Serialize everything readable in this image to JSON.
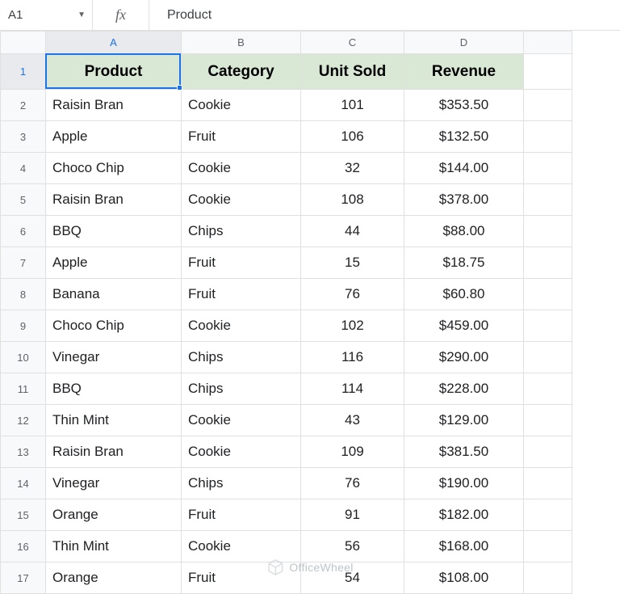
{
  "namebox": {
    "value": "A1"
  },
  "fx_label": "fx",
  "formula_bar": {
    "value": "Product"
  },
  "columns": [
    "A",
    "B",
    "C",
    "D"
  ],
  "selected_col": "A",
  "selected_row": 1,
  "row_numbers": [
    1,
    2,
    3,
    4,
    5,
    6,
    7,
    8,
    9,
    10,
    11,
    12,
    13,
    14,
    15,
    16,
    17
  ],
  "headers": {
    "A": "Product",
    "B": "Category",
    "C": "Unit Sold",
    "D": "Revenue"
  },
  "rows": [
    {
      "product": "Raisin Bran",
      "category": "Cookie",
      "unit_sold": "101",
      "revenue": "$353.50"
    },
    {
      "product": "Apple",
      "category": "Fruit",
      "unit_sold": "106",
      "revenue": "$132.50"
    },
    {
      "product": "Choco Chip",
      "category": "Cookie",
      "unit_sold": "32",
      "revenue": "$144.00"
    },
    {
      "product": "Raisin Bran",
      "category": "Cookie",
      "unit_sold": "108",
      "revenue": "$378.00"
    },
    {
      "product": "BBQ",
      "category": "Chips",
      "unit_sold": "44",
      "revenue": "$88.00"
    },
    {
      "product": "Apple",
      "category": "Fruit",
      "unit_sold": "15",
      "revenue": "$18.75"
    },
    {
      "product": "Banana",
      "category": "Fruit",
      "unit_sold": "76",
      "revenue": "$60.80"
    },
    {
      "product": "Choco Chip",
      "category": "Cookie",
      "unit_sold": "102",
      "revenue": "$459.00"
    },
    {
      "product": "Vinegar",
      "category": "Chips",
      "unit_sold": "116",
      "revenue": "$290.00"
    },
    {
      "product": "BBQ",
      "category": "Chips",
      "unit_sold": "114",
      "revenue": "$228.00"
    },
    {
      "product": "Thin Mint",
      "category": "Cookie",
      "unit_sold": "43",
      "revenue": "$129.00"
    },
    {
      "product": "Raisin Bran",
      "category": "Cookie",
      "unit_sold": "109",
      "revenue": "$381.50"
    },
    {
      "product": "Vinegar",
      "category": "Chips",
      "unit_sold": "76",
      "revenue": "$190.00"
    },
    {
      "product": "Orange",
      "category": "Fruit",
      "unit_sold": "91",
      "revenue": "$182.00"
    },
    {
      "product": "Thin Mint",
      "category": "Cookie",
      "unit_sold": "56",
      "revenue": "$168.00"
    },
    {
      "product": "Orange",
      "category": "Fruit",
      "unit_sold": "54",
      "revenue": "$108.00"
    }
  ],
  "watermark": "OfficeWheel",
  "chart_data": {
    "type": "table",
    "title": "Product sales",
    "columns": [
      "Product",
      "Category",
      "Unit Sold",
      "Revenue"
    ],
    "rows": [
      [
        "Raisin Bran",
        "Cookie",
        101,
        353.5
      ],
      [
        "Apple",
        "Fruit",
        106,
        132.5
      ],
      [
        "Choco Chip",
        "Cookie",
        32,
        144.0
      ],
      [
        "Raisin Bran",
        "Cookie",
        108,
        378.0
      ],
      [
        "BBQ",
        "Chips",
        44,
        88.0
      ],
      [
        "Apple",
        "Fruit",
        15,
        18.75
      ],
      [
        "Banana",
        "Fruit",
        76,
        60.8
      ],
      [
        "Choco Chip",
        "Cookie",
        102,
        459.0
      ],
      [
        "Vinegar",
        "Chips",
        116,
        290.0
      ],
      [
        "BBQ",
        "Chips",
        114,
        228.0
      ],
      [
        "Thin Mint",
        "Cookie",
        43,
        129.0
      ],
      [
        "Raisin Bran",
        "Cookie",
        109,
        381.5
      ],
      [
        "Vinegar",
        "Chips",
        76,
        190.0
      ],
      [
        "Orange",
        "Fruit",
        91,
        182.0
      ],
      [
        "Thin Mint",
        "Cookie",
        56,
        168.0
      ],
      [
        "Orange",
        "Fruit",
        54,
        108.0
      ]
    ]
  }
}
